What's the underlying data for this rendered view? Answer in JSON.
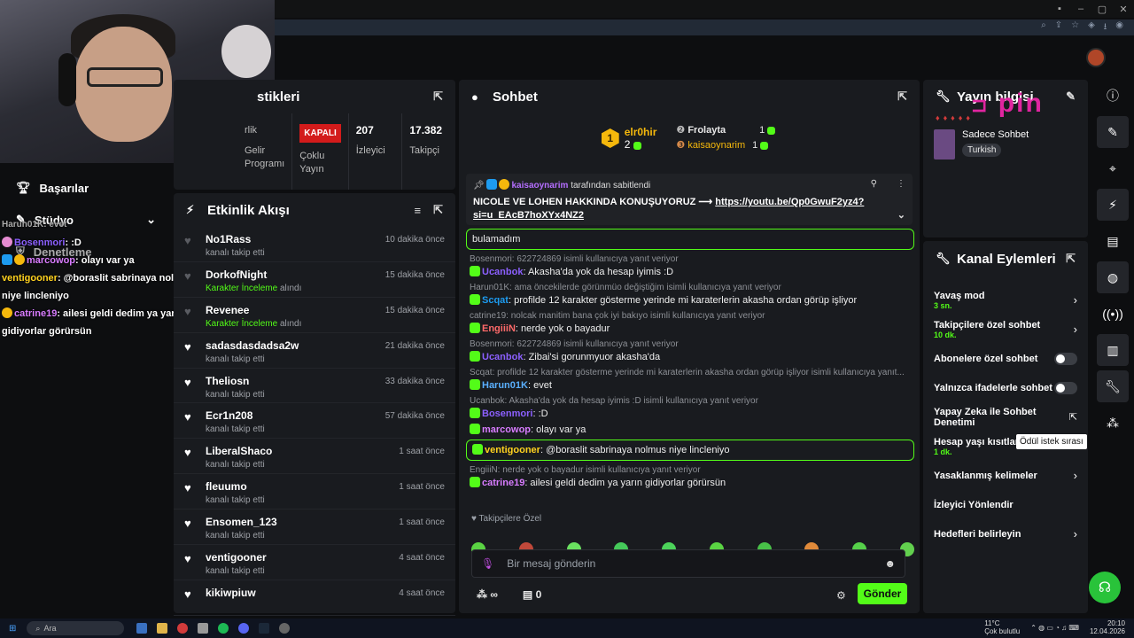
{
  "taskbar": {
    "search_placeholder": "Ara",
    "weather": "11°C",
    "weather_desc": "Çok bulutlu",
    "time": "20:10",
    "date": "12.04.2026"
  },
  "leftnav": {
    "items": [
      {
        "label": "Başarılar",
        "icon": "trophy-icon"
      },
      {
        "label": "Stüdyo",
        "icon": "brush-icon"
      },
      {
        "label": "Denetleme",
        "icon": "shield-icon"
      }
    ]
  },
  "overlay_chat": [
    {
      "user": "Harun01K",
      "text": ": evet",
      "color": "#9da0a6"
    },
    {
      "user": "Bosenmori",
      "text": ": :D",
      "color": "#8c60ff"
    },
    {
      "user": "marcowop",
      "text": ": olayı var ya",
      "color": "#d87cff"
    },
    {
      "user": "ventigooner",
      "text": ": @boraslit sabrinaya nolmus niye lincleniyo",
      "color": "#ffd21f"
    },
    {
      "user": "catrine19",
      "text": ": ailesi geldi dedim ya yarın gidiyorlar görürsün",
      "color": "#d87cff"
    }
  ],
  "stats": {
    "title": "stikleri",
    "cols": [
      {
        "label": "Gelir Programı",
        "value": "rlik"
      },
      {
        "label": "Çoklu Yayın",
        "value": "KAPALI"
      },
      {
        "label": "İzleyici",
        "value": "207"
      },
      {
        "label": "Takipçi",
        "value": "17.382"
      }
    ]
  },
  "activity": {
    "title": "Etkinlik Akışı",
    "items": [
      {
        "name": "No1Rass",
        "sub": "kanalı takip etti",
        "time": "10 dakika önce",
        "active": false,
        "special": false
      },
      {
        "name": "DorkofNight",
        "sub": "Karakter İnceleme",
        "sub2": "alındı",
        "time": "15 dakika önce",
        "active": false,
        "special": true
      },
      {
        "name": "Revenee",
        "sub": "Karakter İnceleme",
        "sub2": "alındı",
        "time": "15 dakika önce",
        "active": false,
        "special": true
      },
      {
        "name": "sadasdasdadsa2w",
        "sub": "kanalı takip etti",
        "time": "21 dakika önce",
        "active": true,
        "special": false
      },
      {
        "name": "Theliosn",
        "sub": "kanalı takip etti",
        "time": "33 dakika önce",
        "active": true,
        "special": false
      },
      {
        "name": "Ecr1n208",
        "sub": "kanalı takip etti",
        "time": "57 dakika önce",
        "active": true,
        "special": false
      },
      {
        "name": "LiberalShaco",
        "sub": "kanalı takip etti",
        "time": "1 saat önce",
        "active": true,
        "special": false
      },
      {
        "name": "fleuumo",
        "sub": "kanalı takip etti",
        "time": "1 saat önce",
        "active": true,
        "special": false
      },
      {
        "name": "Ensomen_123",
        "sub": "kanalı takip etti",
        "time": "1 saat önce",
        "active": true,
        "special": false
      },
      {
        "name": "ventigooner",
        "sub": "kanalı takip etti",
        "time": "4 saat önce",
        "active": true,
        "special": false
      },
      {
        "name": "kikiwpiuw",
        "sub": "",
        "time": "4 saat önce",
        "active": true,
        "special": false
      }
    ]
  },
  "chat": {
    "title": "Sohbet",
    "leaderboard": {
      "first": "elr0hir",
      "first_count": "2",
      "rows": [
        {
          "name": "Frolayta",
          "count": "1"
        },
        {
          "name": "kaisaoynarim",
          "count": "1"
        }
      ]
    },
    "pinned": {
      "by": "kaisaoynarim",
      "by_suffix": "tarafından sabitlendi",
      "msg": "NICOLE VE LOHEN HAKKINDA KONUŞUYORUZ ⟶",
      "link": "https://youtu.be/Qp0GwuF2yz4?si=u_EAcB7hoXYx4NZ2"
    },
    "messages": [
      {
        "reply": "",
        "user": "",
        "text": "bulamadım",
        "highlight": true
      },
      {
        "reply": "Bosenmori: 622724869 isimli kullanıcıya yanıt veriyor",
        "user": "Ucanbok",
        "color": "#8c60ff",
        "text": ": Akasha'da yok da hesap iyimis :D"
      },
      {
        "reply": "Harun01K: ama öncekilerde görünmüo değiştiğim isimli kullanıcıya yanıt veriyor",
        "user": "Scqat",
        "color": "#1d9bf0",
        "text": ": profilde 12 karakter gösterme yerinde mi karaterlerin akasha ordan görüp işliyor"
      },
      {
        "reply": "catrine19: nolcak manitim bana çok iyi bakıyo isimli kullanıcıya yanıt veriyor",
        "user": "EngiiiN",
        "color": "#ff6a6a",
        "text": ": nerde yok o bayadur"
      },
      {
        "reply": "Bosenmori: 622724869 isimli kullanıcıya yanıt veriyor",
        "user": "Ucanbok",
        "color": "#8c60ff",
        "text": ": Zibai'si gorunmyuor akasha'da"
      },
      {
        "reply": "Scqat: profilde 12 karakter gösterme yerinde mi karaterlerin akasha ordan görüp işliyor isimli kullanıcıya yanıt...",
        "user": "Harun01K",
        "color": "#5ab0ff",
        "text": ": evet"
      },
      {
        "reply": "Ucanbok: Akasha'da yok da hesap iyimis :D isimli kullanıcıya yanıt veriyor",
        "user": "Bosenmori",
        "color": "#8c60ff",
        "text": ": :D"
      },
      {
        "reply": "",
        "user": "marcowop",
        "color": "#d87cff",
        "text": ": olayı var ya"
      },
      {
        "reply": "",
        "user": "ventigooner",
        "color": "#ffd21f",
        "text": ": @boraslit sabrinaya nolmus niye lincleniyo",
        "highlight": true
      },
      {
        "reply": "EngiiiN: nerde yok o bayadur isimli kullanıcıya yanıt veriyor",
        "user": "catrine19",
        "color": "#d87cff",
        "text": ": ailesi geldi dedim ya yarın gidiyorlar görürsün"
      }
    ],
    "emote_label": "Takipçilere Özel",
    "input_placeholder": "Bir mesaj gönderin",
    "send_label": "Gönder",
    "subs_count": "0",
    "infinity": "∞"
  },
  "info": {
    "title": "Yayın bilgisi",
    "category": "Sadece Sohbet",
    "language": "Turkish",
    "logo_text": "pin"
  },
  "actions": {
    "title": "Kanal Eylemleri",
    "items": [
      {
        "label": "Yavaş mod",
        "sub": "3 sn.",
        "control": "chevron"
      },
      {
        "label": "Takipçilere özel sohbet",
        "sub": "10 dk.",
        "control": "chevron"
      },
      {
        "label": "Abonelere özel sohbet",
        "sub": "",
        "control": "toggle"
      },
      {
        "label": "Yalnızca ifadelerle sohbet",
        "sub": "",
        "control": "toggle"
      },
      {
        "label": "Yapay Zeka ile Sohbet Denetimi",
        "sub": "",
        "control": "external"
      },
      {
        "label": "Hesap yaşı kısıtlam",
        "sub": "1 dk.",
        "control": "none"
      },
      {
        "label": "Yasaklanmış kelimeler",
        "sub": "",
        "control": "chevron"
      },
      {
        "label": "İzleyici Yönlendir",
        "sub": "",
        "control": "none"
      },
      {
        "label": "Hedefleri belirleyin",
        "sub": "",
        "control": "chevron"
      }
    ]
  },
  "tooltip": "Ödül istek sırası",
  "colors": {
    "accent": "#53fc18",
    "panel": "#191b1f",
    "bg": "#0d0e10"
  }
}
